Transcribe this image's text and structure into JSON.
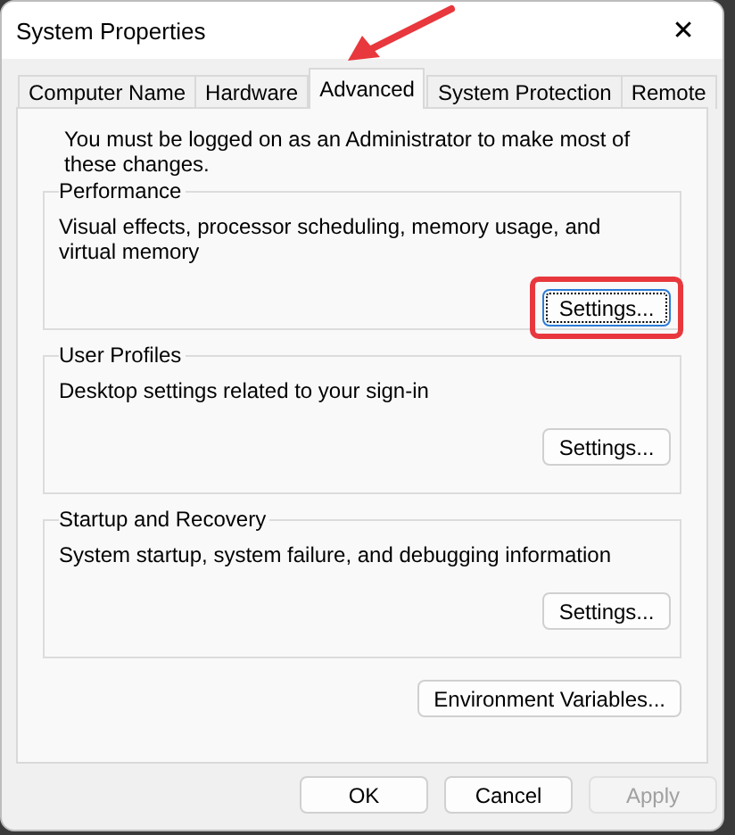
{
  "window": {
    "title": "System Properties",
    "close": "✕"
  },
  "tabs": [
    {
      "label": "Computer Name",
      "selected": false
    },
    {
      "label": "Hardware",
      "selected": false
    },
    {
      "label": "Advanced",
      "selected": true
    },
    {
      "label": "System Protection",
      "selected": false
    },
    {
      "label": "Remote",
      "selected": false
    }
  ],
  "notice": "You must be logged on as an Administrator to make most of these changes.",
  "sections": [
    {
      "title": "Performance",
      "description": "Visual effects, processor scheduling, memory usage, and virtual memory",
      "button": "Settings...",
      "highlighted": true
    },
    {
      "title": "User Profiles",
      "description": "Desktop settings related to your sign-in",
      "button": "Settings...",
      "highlighted": false
    },
    {
      "title": "Startup and Recovery",
      "description": "System startup, system failure, and debugging information",
      "button": "Settings...",
      "highlighted": false
    }
  ],
  "environment_button": "Environment Variables...",
  "buttons": [
    {
      "label": "OK",
      "disabled": false
    },
    {
      "label": "Cancel",
      "disabled": false
    },
    {
      "label": "Apply",
      "disabled": true
    }
  ]
}
